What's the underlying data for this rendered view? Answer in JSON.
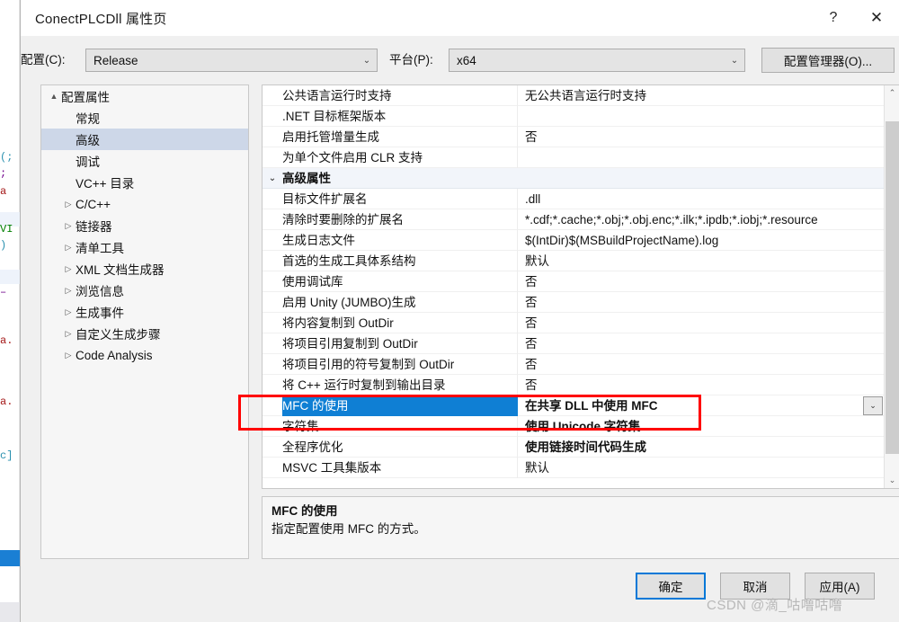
{
  "window": {
    "title": "ConectPLCDll 属性页",
    "help_icon": "?",
    "close_icon": "✕"
  },
  "config_bar": {
    "configuration_label": "配置(C):",
    "configuration_value": "Release",
    "platform_label": "平台(P):",
    "platform_value": "x64",
    "config_manager_button": "配置管理器(O)..."
  },
  "tree": {
    "items": [
      {
        "label": "配置属性",
        "level": 1,
        "arrow": "▲",
        "selected": false
      },
      {
        "label": "常规",
        "level": 2,
        "arrow": "",
        "selected": false
      },
      {
        "label": "高级",
        "level": 2,
        "arrow": "",
        "selected": true
      },
      {
        "label": "调试",
        "level": 2,
        "arrow": "",
        "selected": false
      },
      {
        "label": "VC++ 目录",
        "level": 2,
        "arrow": "",
        "selected": false
      },
      {
        "label": "C/C++",
        "level": 2,
        "arrow": "▷",
        "selected": false
      },
      {
        "label": "链接器",
        "level": 2,
        "arrow": "▷",
        "selected": false
      },
      {
        "label": "清单工具",
        "level": 2,
        "arrow": "▷",
        "selected": false
      },
      {
        "label": "XML 文档生成器",
        "level": 2,
        "arrow": "▷",
        "selected": false
      },
      {
        "label": "浏览信息",
        "level": 2,
        "arrow": "▷",
        "selected": false
      },
      {
        "label": "生成事件",
        "level": 2,
        "arrow": "▷",
        "selected": false
      },
      {
        "label": "自定义生成步骤",
        "level": 2,
        "arrow": "▷",
        "selected": false
      },
      {
        "label": "Code Analysis",
        "level": 2,
        "arrow": "▷",
        "selected": false
      }
    ]
  },
  "grid": {
    "rows": [
      {
        "name": "公共语言运行时支持",
        "value": "无公共语言运行时支持",
        "category": false,
        "selected": false,
        "bold": false,
        "expander": ""
      },
      {
        "name": ".NET 目标框架版本",
        "value": "",
        "category": false,
        "selected": false,
        "bold": false,
        "expander": ""
      },
      {
        "name": "启用托管增量生成",
        "value": "否",
        "category": false,
        "selected": false,
        "bold": false,
        "expander": ""
      },
      {
        "name": "为单个文件启用 CLR 支持",
        "value": "",
        "category": false,
        "selected": false,
        "bold": false,
        "expander": ""
      },
      {
        "name": "高级属性",
        "value": "",
        "category": true,
        "selected": false,
        "bold": false,
        "expander": "⌄"
      },
      {
        "name": "目标文件扩展名",
        "value": ".dll",
        "category": false,
        "selected": false,
        "bold": false,
        "expander": ""
      },
      {
        "name": "清除时要删除的扩展名",
        "value": "*.cdf;*.cache;*.obj;*.obj.enc;*.ilk;*.ipdb;*.iobj;*.resource",
        "category": false,
        "selected": false,
        "bold": false,
        "expander": ""
      },
      {
        "name": "生成日志文件",
        "value": "$(IntDir)$(MSBuildProjectName).log",
        "category": false,
        "selected": false,
        "bold": false,
        "expander": ""
      },
      {
        "name": "首选的生成工具体系结构",
        "value": "默认",
        "category": false,
        "selected": false,
        "bold": false,
        "expander": ""
      },
      {
        "name": "使用调试库",
        "value": "否",
        "category": false,
        "selected": false,
        "bold": false,
        "expander": ""
      },
      {
        "name": "启用 Unity (JUMBO)生成",
        "value": "否",
        "category": false,
        "selected": false,
        "bold": false,
        "expander": ""
      },
      {
        "name": "将内容复制到 OutDir",
        "value": "否",
        "category": false,
        "selected": false,
        "bold": false,
        "expander": ""
      },
      {
        "name": "将项目引用复制到 OutDir",
        "value": "否",
        "category": false,
        "selected": false,
        "bold": false,
        "expander": ""
      },
      {
        "name": "将项目引用的符号复制到 OutDir",
        "value": "否",
        "category": false,
        "selected": false,
        "bold": false,
        "expander": ""
      },
      {
        "name": "将 C++ 运行时复制到输出目录",
        "value": "否",
        "category": false,
        "selected": false,
        "bold": false,
        "expander": ""
      },
      {
        "name": "MFC 的使用",
        "value": "在共享 DLL 中使用 MFC",
        "category": false,
        "selected": true,
        "bold": true,
        "expander": ""
      },
      {
        "name": "字符集",
        "value": "使用 Unicode 字符集",
        "category": false,
        "selected": false,
        "bold": true,
        "expander": ""
      },
      {
        "name": "全程序优化",
        "value": "使用链接时间代码生成",
        "category": false,
        "selected": false,
        "bold": true,
        "expander": ""
      },
      {
        "name": "MSVC 工具集版本",
        "value": "默认",
        "category": false,
        "selected": false,
        "bold": false,
        "expander": ""
      }
    ],
    "row_dropdown_icon": "⌄",
    "scroll_up_icon": "⌃",
    "scroll_down_icon": "⌄"
  },
  "description": {
    "title": "MFC 的使用",
    "body": "指定配置使用 MFC 的方式。"
  },
  "footer": {
    "ok_label": "确定",
    "cancel_label": "取消",
    "apply_label": "应用(A)"
  },
  "watermark": "CSDN @滴_咕噜咕噜",
  "colors": {
    "selection_blue": "#0f7fd4",
    "annotation_red": "#ff0000",
    "tree_selection": "#cdd7e8",
    "default_button_border": "#0078d7"
  }
}
